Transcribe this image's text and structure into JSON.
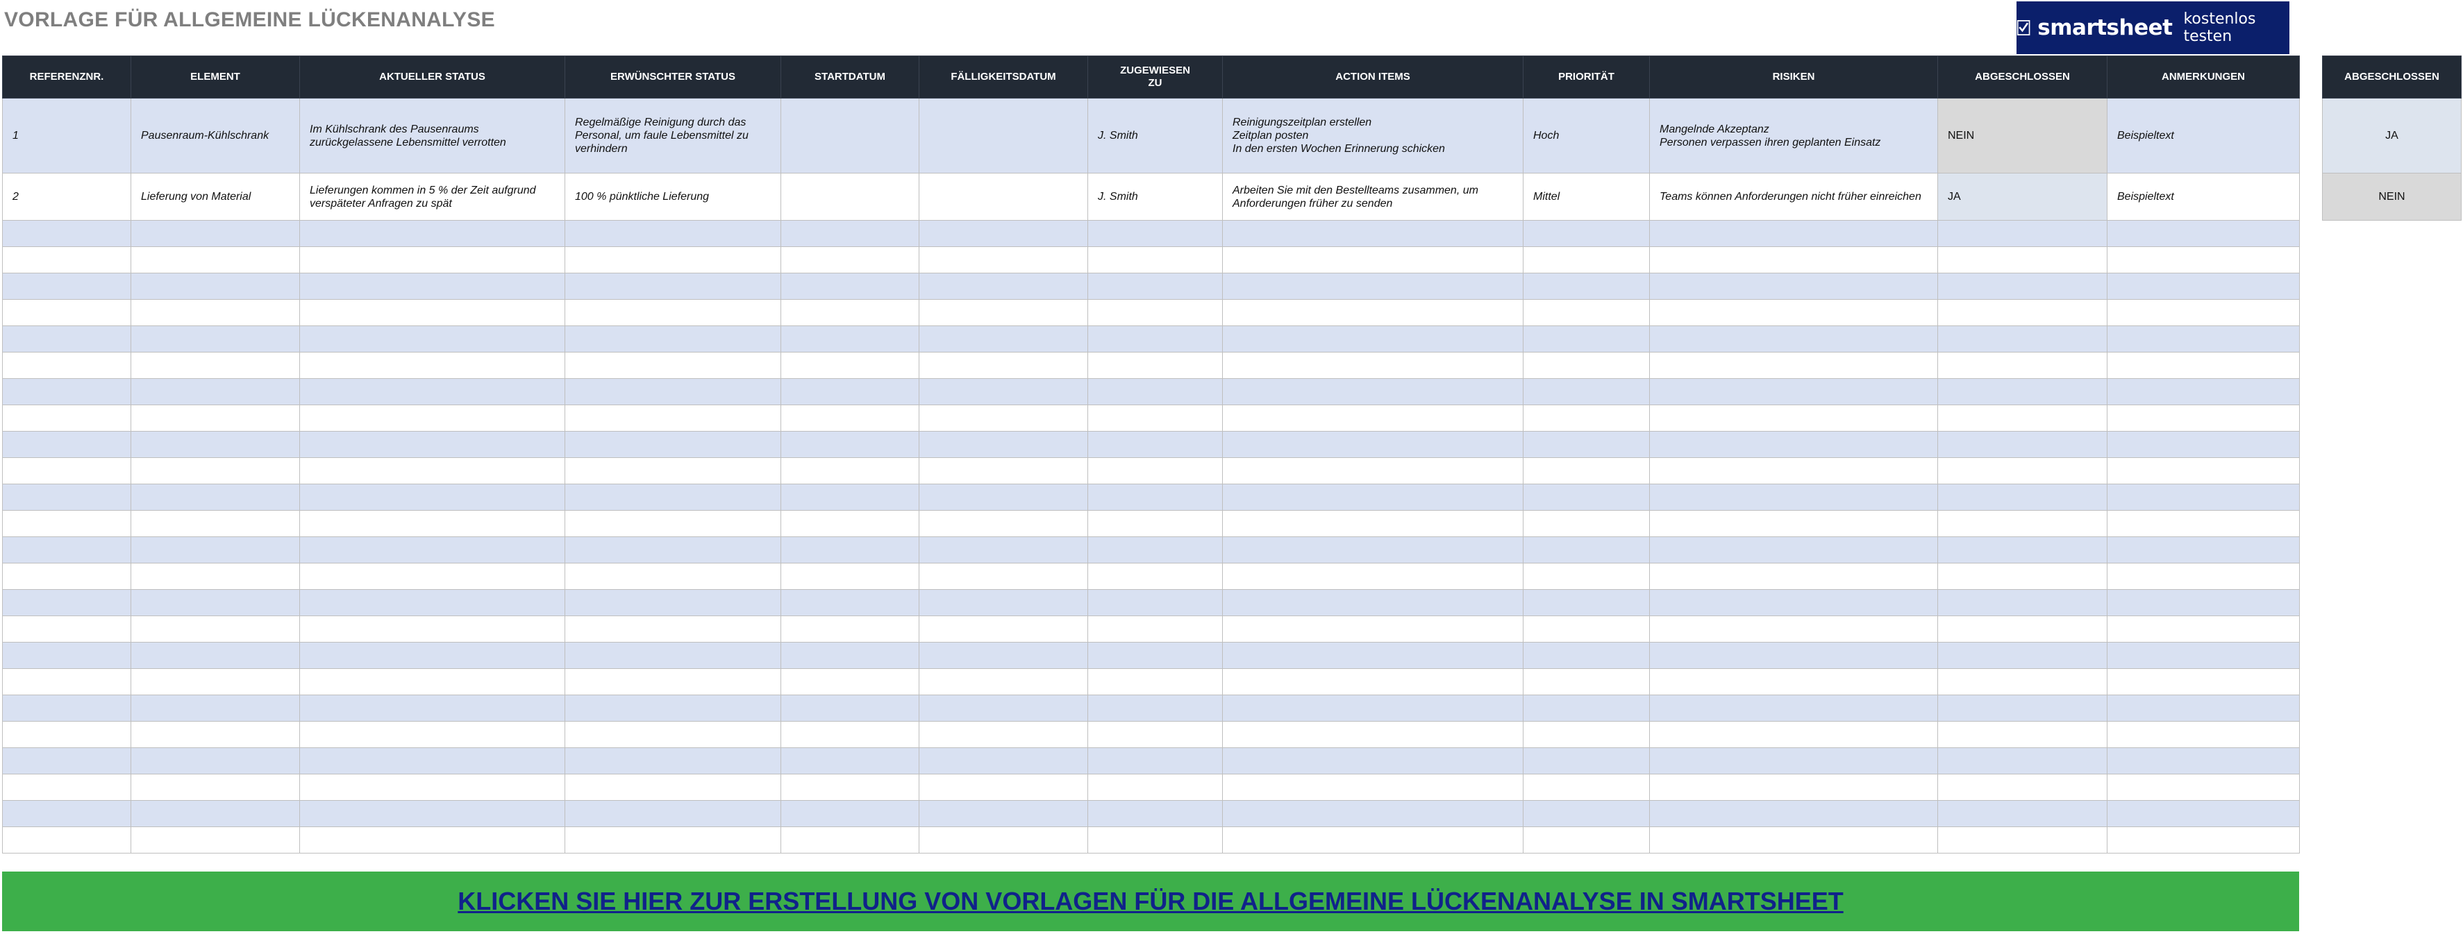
{
  "title": "VORLAGE FÜR ALLGEMEINE LÜCKENANALYSE",
  "promo": {
    "brand": "smartsheet",
    "cta": "kostenlos testen",
    "logo_icon": "smartsheet-check-logo",
    "color": "#0b1f6b"
  },
  "table": {
    "headers": [
      "REFERENZNR.",
      "ELEMENT",
      "AKTUELLER STATUS",
      "ERWÜNSCHTER STATUS",
      "STARTDATUM",
      "FÄLLIGKEITSDATUM",
      "ZUGEWIESEN\nZU",
      "ACTION ITEMS",
      "PRIORITÄT",
      "RISIKEN",
      "ABGESCHLOSSEN",
      "ANMERKUNGEN"
    ],
    "rows": [
      {
        "ref": "1",
        "element": "Pausenraum-Kühlschrank",
        "current_status": "Im Kühlschrank des Pausenraums zurückgelassene Lebensmittel verrotten",
        "desired_status": "Regelmäßige Reinigung durch das Personal, um faule Lebensmittel zu verhindern",
        "start_date": "",
        "due_date": "",
        "assigned_to": "J. Smith",
        "action_items": "Reinigungszeitplan erstellen\nZeitplan posten\nIn den ersten Wochen Erinnerung schicken",
        "priority": "Hoch",
        "risks": "Mangelnde Akzeptanz\nPersonen verpassen ihren geplanten Einsatz",
        "completed": "NEIN",
        "notes": "Beispieltext"
      },
      {
        "ref": "2",
        "element": "Lieferung von Material",
        "current_status": "Lieferungen kommen in 5 % der Zeit aufgrund verspäteter Anfragen zu spät",
        "desired_status": "100 % pünktliche Lieferung",
        "start_date": "",
        "due_date": "",
        "assigned_to": "J. Smith",
        "action_items": "Arbeiten Sie mit den Bestellteams zusammen, um Anforderungen früher zu senden",
        "priority": "Mittel",
        "risks": "Teams können Anforderungen nicht früher einreichen",
        "completed": "JA",
        "notes": "Beispieltext"
      }
    ]
  },
  "side_table": {
    "header": "ABGESCHLOSSEN",
    "options": [
      "JA",
      "NEIN"
    ]
  },
  "banner": {
    "text": "KLICKEN SIE HIER ZUR ERSTELLUNG VON VORLAGEN FÜR DIE ALLGEMEINE LÜCKENANALYSE IN SMARTSHEET",
    "color": "#3daf4a"
  },
  "colors": {
    "header_bg": "#222a35",
    "row_shaded": "#d9e1f2",
    "title": "#7f7f7f"
  }
}
